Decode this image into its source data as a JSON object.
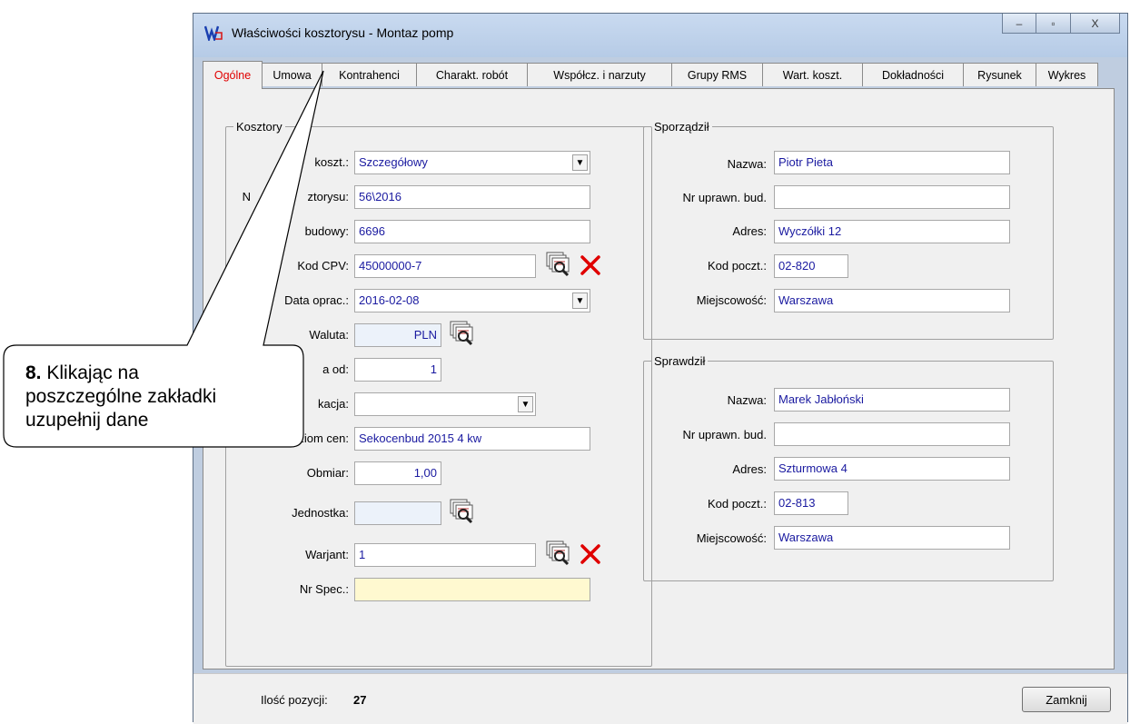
{
  "window": {
    "title": "Właściwości kosztorysu - Montaz pomp",
    "controls": {
      "minimize": "–",
      "maximize": "▫",
      "close": "X"
    }
  },
  "tabs": [
    {
      "label": "Ogólne",
      "active": true
    },
    {
      "label": "Umowa"
    },
    {
      "label": "Kontrahenci"
    },
    {
      "label": "Charakt. robót"
    },
    {
      "label": "Współcz. i narzuty"
    },
    {
      "label": "Grupy RMS"
    },
    {
      "label": "Wart. koszt."
    },
    {
      "label": "Dokładności"
    },
    {
      "label": "Rysunek"
    },
    {
      "label": "Wykres"
    }
  ],
  "kosztorys": {
    "legend": "Kosztory",
    "typ_label": "koszt.:",
    "typ_value": "Szczegółowy",
    "nr_label_pre": "N",
    "nr_label": "ztorysu:",
    "nr_value": "56\\2016",
    "budowy_label": "budowy:",
    "budowy_value": "6696",
    "cpv_label": "Kod CPV:",
    "cpv_value": "45000000-7",
    "data_label": "Data oprac.:",
    "data_value": "2016-02-08",
    "waluta_label": "Waluta:",
    "waluta_value": "PLN",
    "kurs_label": "a  od:",
    "kurs_value": "1",
    "lok_label": "kacja:",
    "lok_value": "",
    "poziom_label": "Poziom cen:",
    "poziom_value": "Sekocenbud 2015 4 kw",
    "obmiar_label": "Obmiar:",
    "obmiar_value": "1,00",
    "jednostka_label": "Jednostka:",
    "jednostka_value": "",
    "wariant_label": "Warjant:",
    "wariant_value": "1",
    "spec_label": "Nr Spec.:",
    "spec_value": ""
  },
  "sporzadzil": {
    "legend": "Sporządził",
    "nazwa_label": "Nazwa:",
    "nazwa_value": "Piotr Pieta",
    "upr_label": "Nr uprawn. bud.",
    "upr_value": "",
    "adres_label": "Adres:",
    "adres_value": "Wyczółki 12",
    "kod_label": "Kod poczt.:",
    "kod_value": "02-820",
    "miejsc_label": "Miejscowość:",
    "miejsc_value": "Warszawa"
  },
  "sprawdzil": {
    "legend": "Sprawdził",
    "nazwa_label": "Nazwa:",
    "nazwa_value": "Marek Jabłoński",
    "upr_label": "Nr uprawn. bud.",
    "upr_value": "",
    "adres_label": "Adres:",
    "adres_value": "Szturmowa 4",
    "kod_label": "Kod poczt.:",
    "kod_value": "02-813",
    "miejsc_label": "Miejscowość:",
    "miejsc_value": "Warszawa"
  },
  "status": {
    "count_label": "Ilość pozycji:",
    "count_value": "27",
    "close_button": "Zamknij"
  },
  "callout": {
    "number": "8.",
    "line1": " Klikając na",
    "line2": "poszczególne zakładki",
    "line3": "uzupełnij dane"
  },
  "colors": {
    "active_tab": "#e00000",
    "field_text": "#1a1aa0",
    "delete_icon": "#e00000"
  },
  "icons": [
    "app-logo-icon",
    "lookup-icon",
    "delete-icon",
    "dropdown-arrow-icon"
  ]
}
